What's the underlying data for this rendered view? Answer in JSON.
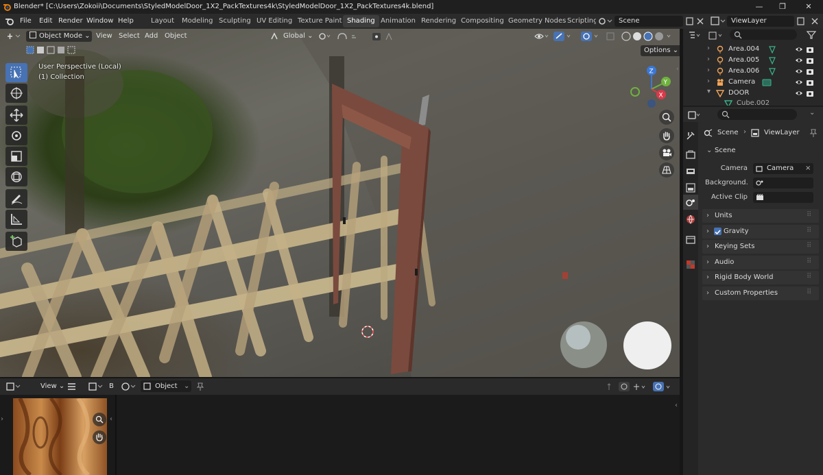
{
  "window": {
    "title": "Blender* [C:\\Users\\Zokoii\\Documents\\StyledModelDoor_1X2_PackTextures4k\\StyledModelDoor_1X2_PackTextures4k.blend]",
    "minimize": "—",
    "maximize": "❐",
    "close": "✕"
  },
  "menubar": {
    "items": [
      "File",
      "Edit",
      "Render",
      "Window",
      "Help"
    ],
    "workspaces": [
      "Layout",
      "Modeling",
      "Sculpting",
      "UV Editing",
      "Texture Paint",
      "Shading",
      "Animation",
      "Rendering",
      "Compositing",
      "Geometry Nodes",
      "Scripting"
    ],
    "active_workspace": "Shading",
    "scene": "Scene",
    "view_layer": "ViewLayer"
  },
  "viewport_header": {
    "mode": "Object Mode",
    "menus": [
      "View",
      "Select",
      "Add",
      "Object"
    ],
    "orientation": "Global",
    "options": "Options"
  },
  "viewport": {
    "perspective": "User Perspective (Local)",
    "collection": "(1) Collection",
    "gizmo": {
      "x": "X",
      "y": "Y",
      "z": "Z"
    }
  },
  "outliner": {
    "rows": [
      {
        "name": "Area.004",
        "icon": "light-icon"
      },
      {
        "name": "Area.005",
        "icon": "light-icon"
      },
      {
        "name": "Area.006",
        "icon": "light-icon"
      },
      {
        "name": "Camera",
        "icon": "camera-icon"
      },
      {
        "name": "DOOR",
        "icon": "mesh-icon"
      },
      {
        "name": "Cube.002",
        "icon": "mesh-icon"
      }
    ]
  },
  "properties": {
    "breadcrumb": {
      "scene": "Scene",
      "view_layer": "ViewLayer"
    },
    "scene_panel": "Scene",
    "camera_label": "Camera",
    "camera_value": "Camera",
    "background_label": "Background...",
    "active_clip_label": "Active Clip",
    "sections": [
      "Units",
      "Gravity",
      "Keying Sets",
      "Audio",
      "Rigid Body World",
      "Custom Properties"
    ],
    "gravity_checked": true
  },
  "bottom": {
    "view": "View",
    "b_label": "B",
    "object": "Object"
  },
  "colors": {
    "accent": "#4772b3",
    "door": "#7a4a3e",
    "background": "#1d1d1d"
  }
}
